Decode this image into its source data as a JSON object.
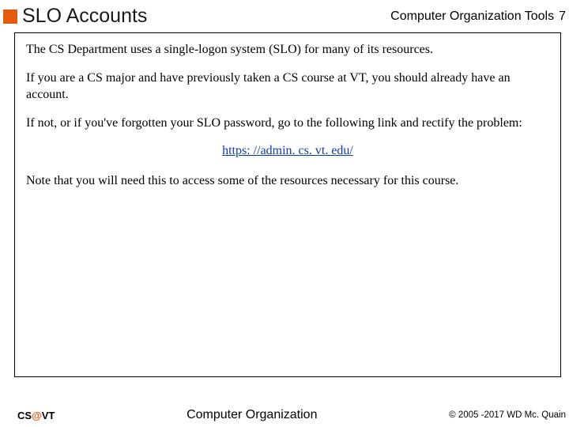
{
  "header": {
    "title": "SLO Accounts",
    "course_label": "Computer Organization Tools",
    "page_number": "7"
  },
  "body": {
    "p1": "The CS Department uses a single-logon system (SLO) for many of its resources.",
    "p2": "If you are a CS major and have previously taken a CS course at VT, you should already have an account.",
    "p3": "If not, or if you've forgotten your SLO password, go to the following link and rectify the problem:",
    "link": "https: //admin. cs. vt. edu/",
    "p4": "Note that you will need this to access some of the resources necessary for this course."
  },
  "footer": {
    "org_pre": "CS",
    "org_at": "@",
    "org_post": "VT",
    "center": "Computer Organization",
    "right": "© 2005 -2017 WD Mc. Quain"
  }
}
